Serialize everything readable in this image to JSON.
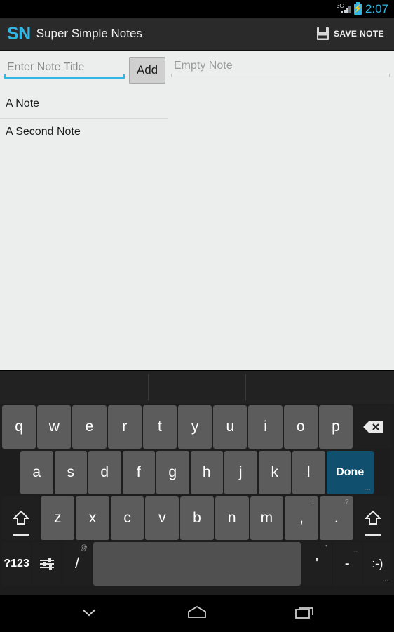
{
  "status_bar": {
    "network_label": "3G",
    "network_icon": "signal-3g-icon",
    "battery_icon": "battery-charging-icon",
    "time": "2:07"
  },
  "action_bar": {
    "logo": "SN",
    "title": "Super Simple Notes",
    "save_icon": "floppy-disk-icon",
    "save_label": "SAVE NOTE",
    "accent_color": "#33b5e5",
    "background_color": "#2a2a2a"
  },
  "editor": {
    "title_input": {
      "value": "",
      "placeholder": "Enter Note Title",
      "focused": true,
      "underline_color": "#33b5e5"
    },
    "add_button": {
      "label": "Add"
    },
    "note_input": {
      "value": "",
      "placeholder": "Empty Note",
      "focused": false,
      "underline_color": "#c6c6c6"
    }
  },
  "note_list": {
    "items": [
      {
        "title": "A Note"
      },
      {
        "title": "A Second Note"
      }
    ]
  },
  "keyboard": {
    "suggestions": [
      "",
      "",
      ""
    ],
    "row1": [
      {
        "label": "q"
      },
      {
        "label": "w"
      },
      {
        "label": "e"
      },
      {
        "label": "r"
      },
      {
        "label": "t"
      },
      {
        "label": "y"
      },
      {
        "label": "u"
      },
      {
        "label": "i"
      },
      {
        "label": "o"
      },
      {
        "label": "p"
      }
    ],
    "backspace": {
      "icon": "backspace-icon",
      "label": ""
    },
    "row2": [
      {
        "label": "a"
      },
      {
        "label": "s"
      },
      {
        "label": "d"
      },
      {
        "label": "f"
      },
      {
        "label": "g"
      },
      {
        "label": "h"
      },
      {
        "label": "j"
      },
      {
        "label": "k"
      },
      {
        "label": "l"
      }
    ],
    "done_key": {
      "label": "Done",
      "color": "#10506e"
    },
    "row3": [
      {
        "label": "z"
      },
      {
        "label": "x"
      },
      {
        "label": "c"
      },
      {
        "label": "v"
      },
      {
        "label": "b"
      },
      {
        "label": "n"
      },
      {
        "label": "m"
      },
      {
        "label": ",",
        "sup": "!"
      },
      {
        "label": ".",
        "sup": "?"
      }
    ],
    "shift_left": {
      "icon": "shift-icon"
    },
    "shift_right": {
      "icon": "shift-icon"
    },
    "row4": {
      "symbols_key": {
        "label": "?123"
      },
      "settings_key": {
        "icon": "keyboard-settings-icon"
      },
      "slash_key": {
        "label": "/",
        "sup": "@"
      },
      "space_key": {
        "label": ""
      },
      "apostrophe_key": {
        "label": "'",
        "sup": "\""
      },
      "dash_key": {
        "label": "-",
        "sup": "_"
      },
      "emoji_key": {
        "label": ":-)"
      }
    }
  },
  "nav_bar": {
    "back": {
      "icon": "hide-keyboard-chevron-icon"
    },
    "home": {
      "icon": "home-icon"
    },
    "recents": {
      "icon": "recents-icon"
    }
  }
}
